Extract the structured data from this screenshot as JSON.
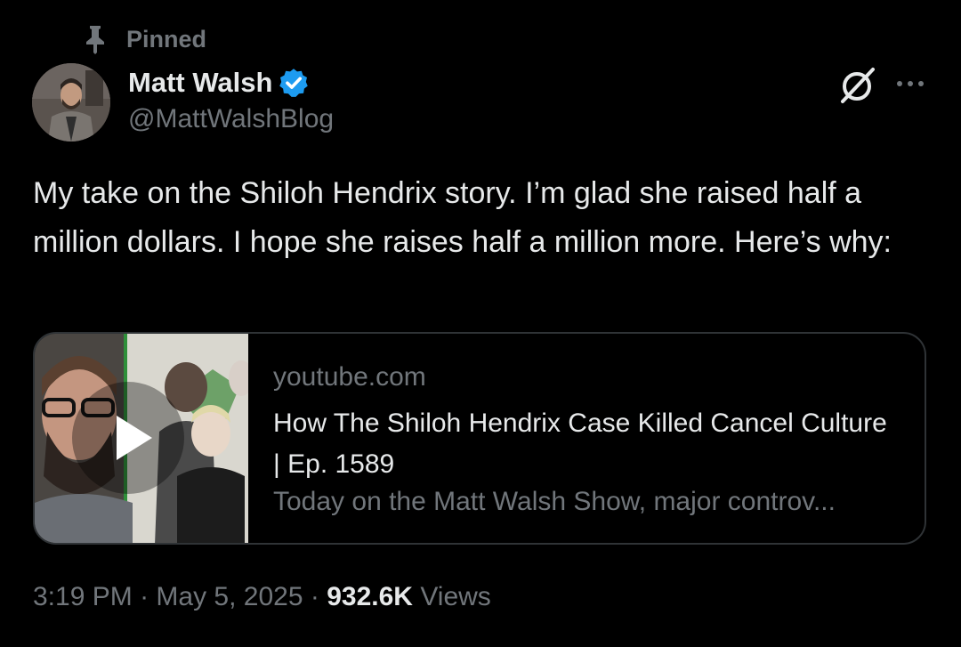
{
  "pinned": {
    "label": "Pinned",
    "icon": "pin-icon"
  },
  "author": {
    "name": "Matt Walsh",
    "handle": "@MattWalshBlog",
    "verified_icon": "verified-badge-icon",
    "verified_color": "#1d9bf0"
  },
  "actions": {
    "grok_icon": "grok-icon",
    "more_icon": "more-options-icon"
  },
  "post": {
    "text": "My take on the Shiloh Hendrix story. I’m glad she raised half a million dollars. I hope she raises half a million more. Here’s why:"
  },
  "card": {
    "domain": "youtube.com",
    "title": "How The Shiloh Hendrix Case Killed Cancel Culture | Ep. 1589",
    "description": "Today on the Matt Walsh Show, major controv...",
    "play_icon": "play-icon"
  },
  "meta": {
    "time": "3:19 PM",
    "separator": "·",
    "date": "May 5, 2025",
    "views_count": "932.6K",
    "views_label": "Views"
  },
  "colors": {
    "background": "#000000",
    "text_primary": "#e7e9ea",
    "text_secondary": "#71767b",
    "border": "#2f3336"
  }
}
